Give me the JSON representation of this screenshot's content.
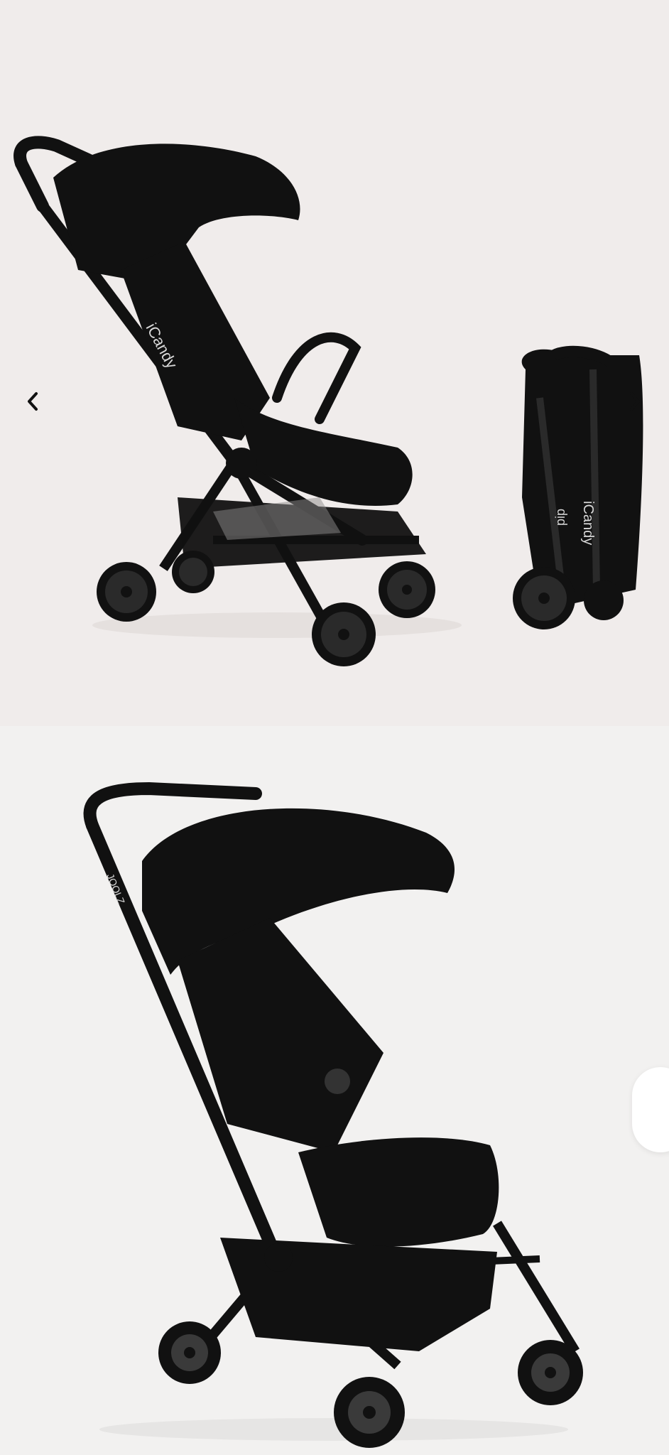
{
  "gallery_top": {
    "brand_label": "iCandy",
    "fold_brand_label": "iCandy",
    "fold_model_label": "pip",
    "prev_icon": "chevron-left-icon",
    "next_icon": "chevron-right-icon"
  },
  "gallery_bottom": {
    "frame_label": "JOOLZ"
  },
  "colors": {
    "background_top": "#f0eceb",
    "background_bottom": "#f2f1f0",
    "stroller": "#111111",
    "wheel_hub": "#2a2a2a"
  }
}
